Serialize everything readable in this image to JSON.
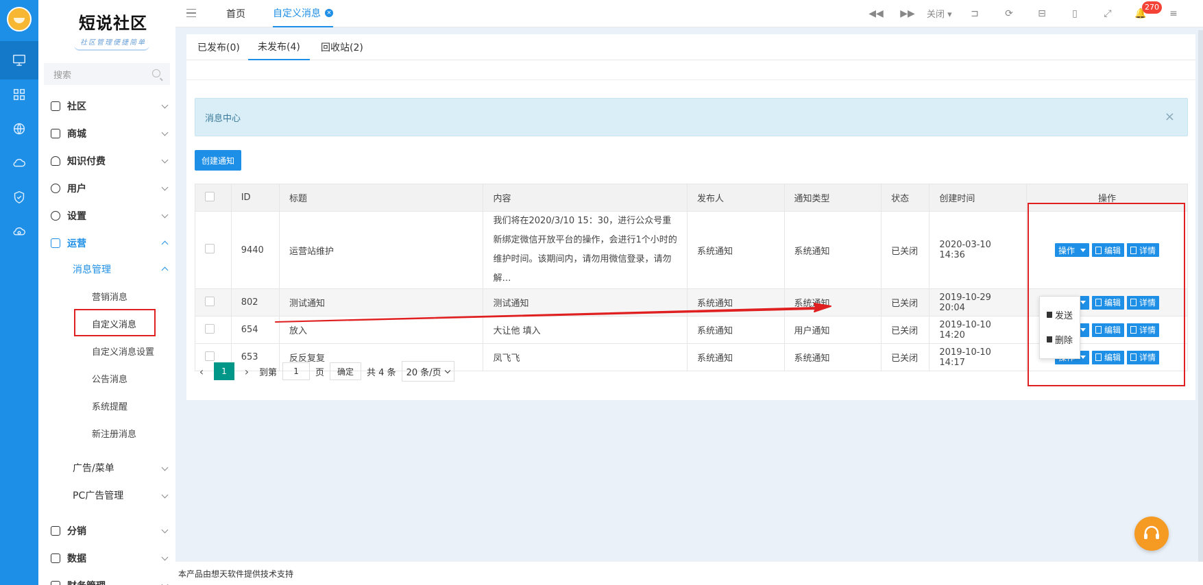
{
  "app": {
    "brand_title": "短说社区",
    "brand_subtitle": "社区管理便捷简单"
  },
  "rail": [
    "desktop-icon",
    "grid-icon",
    "globe-icon",
    "cloud-icon",
    "shield-icon",
    "cloud-sync-icon"
  ],
  "sidebar": {
    "search_placeholder": "搜索",
    "groups": [
      {
        "label": "社区"
      },
      {
        "label": "商城"
      },
      {
        "label": "知识付费"
      },
      {
        "label": "用户"
      },
      {
        "label": "设置"
      },
      {
        "label": "运营"
      }
    ],
    "subgroup": "消息管理",
    "leaves": [
      "营销消息",
      "自定义消息",
      "自定义消息设置",
      "公告消息",
      "系统提醒",
      "新注册消息"
    ],
    "plain_groups": [
      "广告/菜单",
      "PC广告管理"
    ],
    "bottom_groups": [
      "分销",
      "数据",
      "财务管理"
    ]
  },
  "topbar": {
    "tabs": [
      "首页",
      "自定义消息"
    ],
    "close_label": "关闭",
    "notification_count": "270"
  },
  "subtabs": [
    "已发布(0)",
    "未发布(4)",
    "回收站(2)"
  ],
  "alert": {
    "text": "消息中心",
    "close": "×"
  },
  "create_button": "创建通知",
  "table": {
    "headers": [
      "ID",
      "标题",
      "内容",
      "发布人",
      "通知类型",
      "状态",
      "创建时间",
      "操作"
    ],
    "rows": [
      {
        "id": "9440",
        "title": "运营站维护",
        "content": "我们将在2020/3/10 15：30，进行公众号重新绑定微信开放平台的操作，会进行1个小时的维护时间。该期间内，请勿用微信登录，请勿解…",
        "publisher": "系统通知",
        "type": "系统通知",
        "status": "已关闭",
        "created": "2020-03-10 14:36"
      },
      {
        "id": "802",
        "title": "测试通知",
        "content": "测试通知",
        "publisher": "系统通知",
        "type": "系统通知",
        "status": "已关闭",
        "created": "2019-10-29 20:04"
      },
      {
        "id": "654",
        "title": "放入",
        "content": "大让他 填入",
        "publisher": "系统通知",
        "type": "用户通知",
        "status": "已关闭",
        "created": "2019-10-10 14:20"
      },
      {
        "id": "653",
        "title": "反反复复",
        "content": "凤飞飞",
        "publisher": "系统通知",
        "type": "系统通知",
        "status": "已关闭",
        "created": "2019-10-10 14:17"
      }
    ],
    "op_labels": {
      "action": "操作",
      "edit": "编辑",
      "detail": "详情"
    }
  },
  "dropdown": [
    "发送",
    "删除"
  ],
  "pager": {
    "current": "1",
    "goto_label": "到第",
    "goto_value": "1",
    "page_unit": "页",
    "confirm": "确定",
    "total": "共 4 条",
    "page_size": "20 条/页"
  },
  "footer": "本产品由想天软件提供技术支持",
  "colors": {
    "primary": "#1e8fe6",
    "pager_active": "#009688",
    "badge": "#f44336",
    "annotation": "#e02020"
  }
}
